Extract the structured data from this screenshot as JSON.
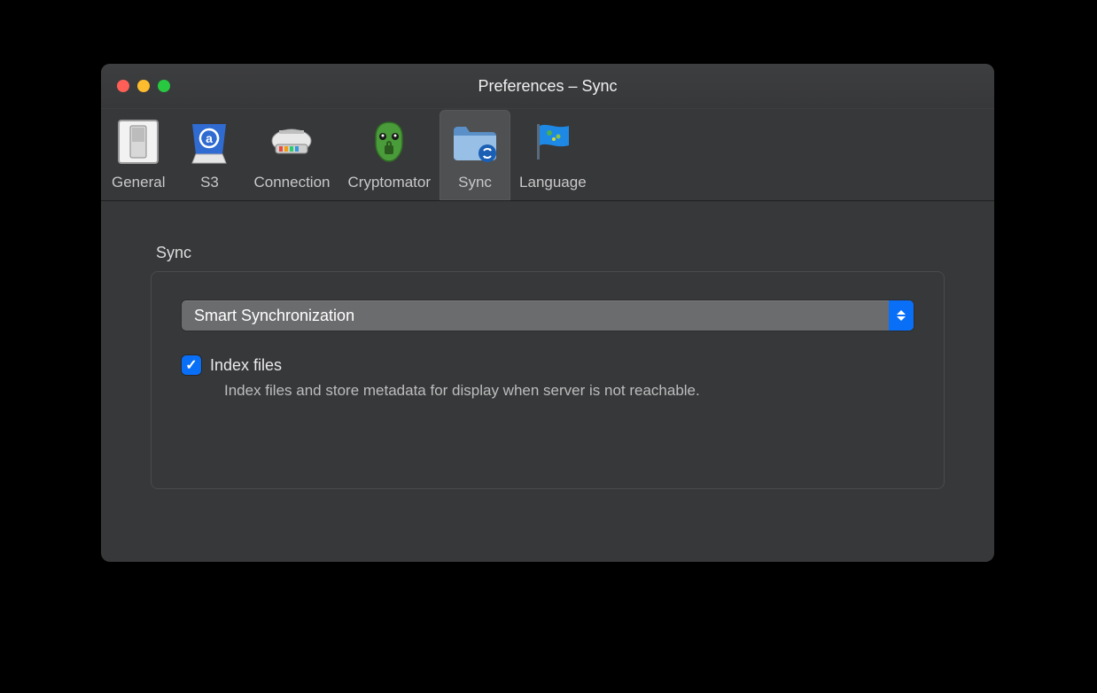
{
  "window": {
    "title": "Preferences – Sync"
  },
  "toolbar": {
    "items": [
      {
        "id": "general",
        "label": "General",
        "icon": "switch-icon",
        "selected": false
      },
      {
        "id": "s3",
        "label": "S3",
        "icon": "s3-icon",
        "selected": false
      },
      {
        "id": "connection",
        "label": "Connection",
        "icon": "connection-icon",
        "selected": false
      },
      {
        "id": "cryptomator",
        "label": "Cryptomator",
        "icon": "cryptomator-icon",
        "selected": false
      },
      {
        "id": "sync",
        "label": "Sync",
        "icon": "folder-sync-icon",
        "selected": true
      },
      {
        "id": "language",
        "label": "Language",
        "icon": "flag-icon",
        "selected": false
      }
    ]
  },
  "panel": {
    "section_label": "Sync",
    "select_value": "Smart Synchronization",
    "checkbox": {
      "checked": true,
      "label": "Index files",
      "description": "Index files and store metadata for display when server is not reachable."
    }
  }
}
